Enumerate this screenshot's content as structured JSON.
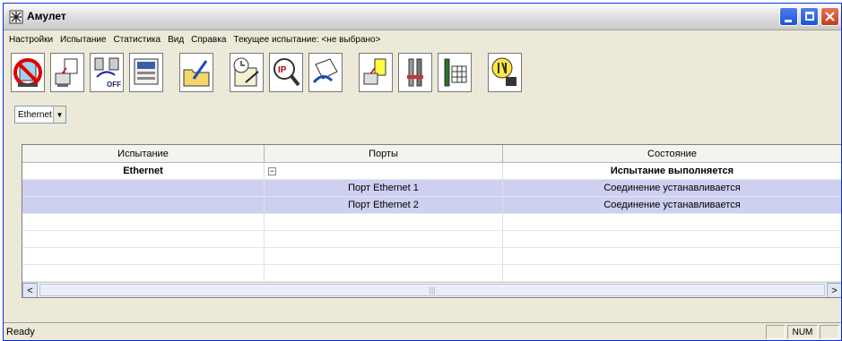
{
  "window": {
    "title": "Амулет"
  },
  "menu": {
    "items": [
      "Настройки",
      "Испытание",
      "Статистика",
      "Вид",
      "Справка"
    ],
    "current_test_label": "Текущее испытание: <не выбрано>"
  },
  "toolbar": {
    "buttons": [
      {
        "icon": "stop-sign-icon"
      },
      {
        "icon": "terminal-icon"
      },
      {
        "icon": "network-off-icon",
        "label": "OFF"
      },
      {
        "icon": "monitor-window-icon"
      },
      {
        "icon": "folder-edit-icon"
      },
      {
        "icon": "clock-edit-icon"
      },
      {
        "icon": "ip-search-icon",
        "label": "IP"
      },
      {
        "icon": "hand-document-icon"
      },
      {
        "icon": "terminal-ethernet-icon"
      },
      {
        "icon": "tools-icon"
      },
      {
        "icon": "tools-grid-icon"
      },
      {
        "icon": "info-settings-icon"
      }
    ]
  },
  "filter": {
    "selected": "Ethernet"
  },
  "grid": {
    "columns": [
      "Испытание",
      "Порты",
      "Состояние"
    ],
    "rows": [
      {
        "test": "Ethernet",
        "port": "",
        "status": "Испытание выполняется"
      },
      {
        "test": "",
        "port": "Порт Ethernet 1",
        "status": "Соединение устанавливается"
      },
      {
        "test": "",
        "port": "Порт Ethernet 2",
        "status": "Соединение устанавливается"
      }
    ],
    "expander_symbol": "−"
  },
  "status": {
    "text": "Ready",
    "num": "NUM"
  },
  "colors": {
    "selection": "#cdd0f0",
    "titlebar_button": "#1e52d8",
    "close_button": "#c13d1d"
  }
}
